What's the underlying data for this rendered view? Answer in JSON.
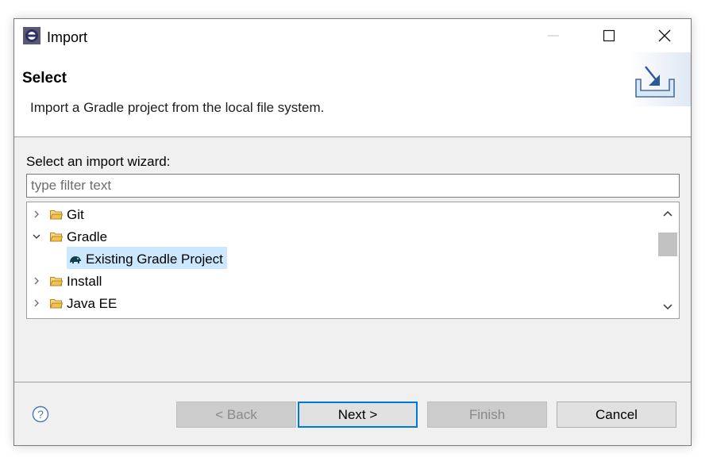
{
  "window": {
    "title": "Import"
  },
  "banner": {
    "title": "Select",
    "description": "Import a Gradle project from the local file system."
  },
  "wizard": {
    "label": "Select an import wizard:",
    "filter_placeholder": "type filter text",
    "filter_value": "",
    "tree": [
      {
        "label": "Git",
        "expanded": false,
        "icon": "folder-icon"
      },
      {
        "label": "Gradle",
        "expanded": true,
        "icon": "folder-icon"
      },
      {
        "label": "Existing Gradle Project",
        "selected": true,
        "icon": "gradle-elephant-icon"
      },
      {
        "label": "Install",
        "expanded": false,
        "icon": "folder-icon"
      },
      {
        "label": "Java EE",
        "expanded": false,
        "icon": "folder-icon"
      }
    ]
  },
  "buttons": {
    "back": "< Back",
    "next": "Next >",
    "finish": "Finish",
    "cancel": "Cancel"
  },
  "colors": {
    "selection": "#cce8ff",
    "default_button_border": "#0078d7",
    "folder": "#e0a93b"
  }
}
